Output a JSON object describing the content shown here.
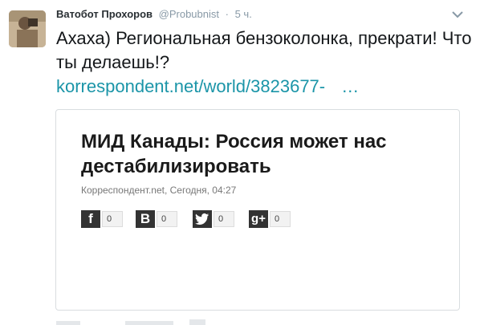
{
  "tweet": {
    "author_name": "Ватобот Прохоров",
    "handle": "@Probubnist",
    "separator": "·",
    "time": "5 ч.",
    "text": "Ахаха) Региональная бензоколонка, прекрати! Что ты делаешь!?",
    "link": "korrespondent.net/world/3823677-",
    "link_ellipsis": "…"
  },
  "card": {
    "title": "МИД Канады: Россия может нас дестабилизировать",
    "meta": "Корреспондент.net, Сегодня, 04:27",
    "shares": [
      {
        "icon": "facebook-icon",
        "glyph": "f",
        "count": "0"
      },
      {
        "icon": "vkontakte-icon",
        "glyph": "B",
        "count": "0"
      },
      {
        "icon": "twitter-icon",
        "glyph": "🐦",
        "count": "0"
      },
      {
        "icon": "google-plus-icon",
        "glyph": "g+",
        "count": "0"
      }
    ]
  },
  "colors": {
    "link": "#1b95a8",
    "muted": "#8899a6",
    "icon_bg": "#333333"
  }
}
